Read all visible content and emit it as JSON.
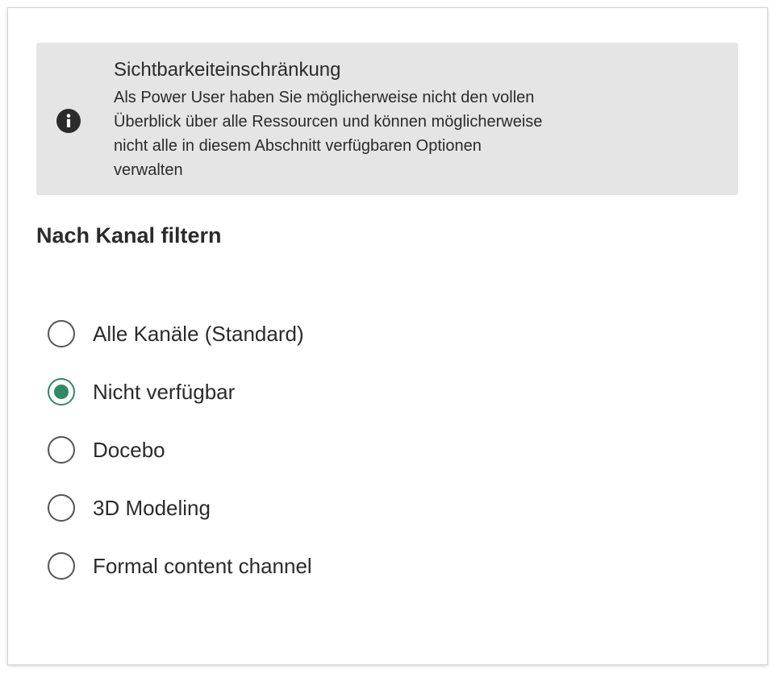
{
  "notice": {
    "icon": "info-icon",
    "title": "Sichtbarkeiteinschränkung",
    "lines": [
      "Als Power User haben Sie möglicherweise nicht den vollen",
      "Überblick über alle Ressourcen und können möglicherweise",
      "nicht alle in diesem Abschnitt verfügbaren Optionen",
      "verwalten"
    ],
    "background_color": "#e4e5e4"
  },
  "filter": {
    "title": "Nach Kanal filtern",
    "selected_index": 1,
    "accent_color": "#2e8a64",
    "options": [
      {
        "label": "Alle Kanäle (Standard)"
      },
      {
        "label": "Nicht verfügbar"
      },
      {
        "label": "Docebo"
      },
      {
        "label": "3D Modeling"
      },
      {
        "label": "Formal content channel"
      }
    ]
  }
}
